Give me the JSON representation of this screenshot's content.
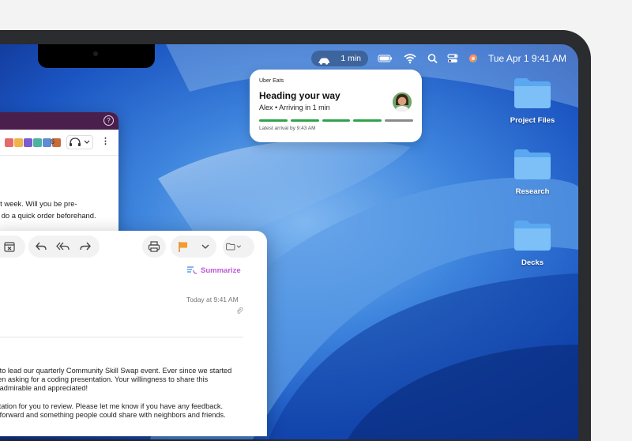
{
  "menubar": {
    "live_activity_time": "1 min",
    "datetime": "Tue Apr 1  9:41 AM",
    "icons": [
      "car-icon",
      "battery-icon",
      "wifi-icon",
      "search-icon",
      "control-center-icon",
      "siri-icon"
    ]
  },
  "notification": {
    "app_name": "Uber Eats",
    "title": "Heading your way",
    "subtitle": "Alex • Arriving in 1 min",
    "latest_arrival": "Latest arrival by 9:43 AM",
    "progress_segments_done": 4,
    "progress_segments_total": 5,
    "accent": "#31a24c"
  },
  "desktop": {
    "folders": [
      {
        "label": "Project Files"
      },
      {
        "label": "Research"
      },
      {
        "label": "Decks"
      }
    ]
  },
  "slack": {
    "member_count": "6",
    "message_lines": [
      "lunch next week. Will you be pre-",
      "uld easily do a quick order beforehand."
    ]
  },
  "mail": {
    "summarize_label": "Summarize",
    "date": "Today at 9:41 AM",
    "paren": ")",
    "body_lines": [
      "g to lead our quarterly Community Skill Swap event. Ever since we started",
      "een asking for a coding presentation. Your willingness to share this",
      "h admirable and appreciated!",
      "vitation for you to review. Please let me know if you have any feedback.",
      "htforward and something people could share with neighbors and friends."
    ]
  }
}
